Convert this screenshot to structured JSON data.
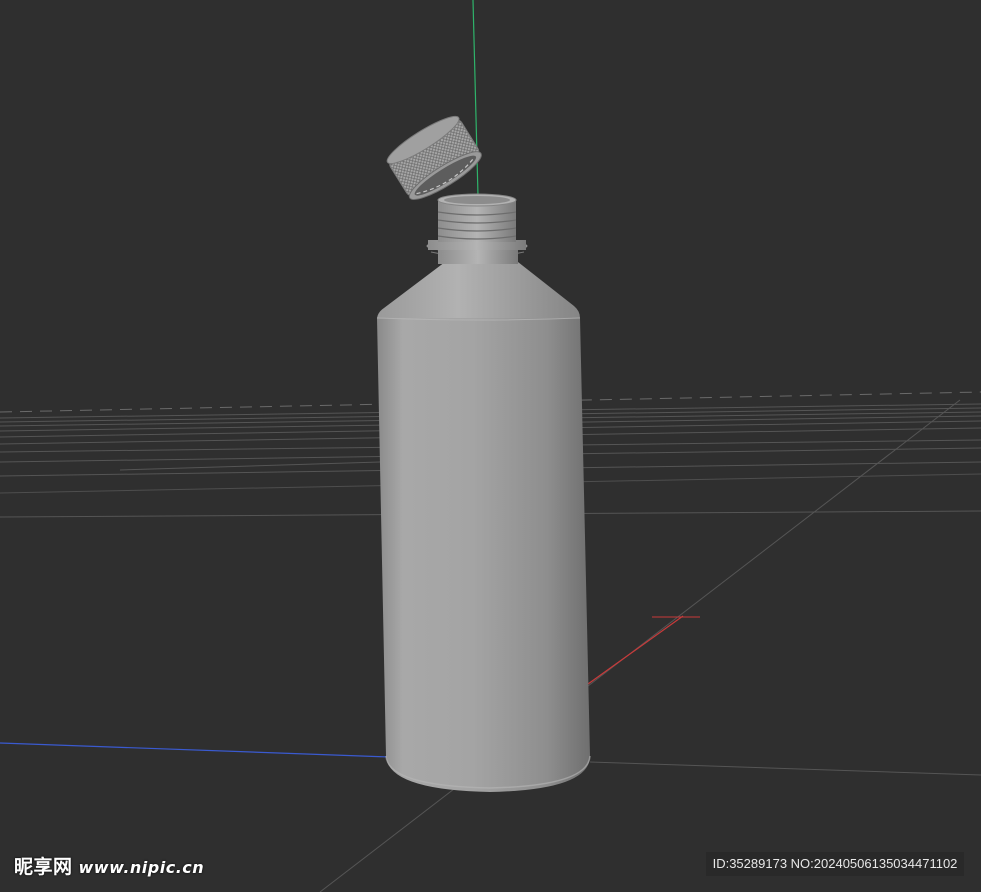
{
  "scene": {
    "background": "#2f2f2f",
    "grid_color": "#5a5a5a",
    "axis_colors": {
      "x": "#c83a3a",
      "y": "#2fb36a",
      "z": "#3a5ad0"
    },
    "object": "plastic-bottle-with-open-cap",
    "object_color": "#9e9e9e"
  },
  "watermark": {
    "site_name": "昵享网",
    "site_url": "www.nipic.cn",
    "id_text": "ID:35289173 NO:20240506135034471102"
  }
}
